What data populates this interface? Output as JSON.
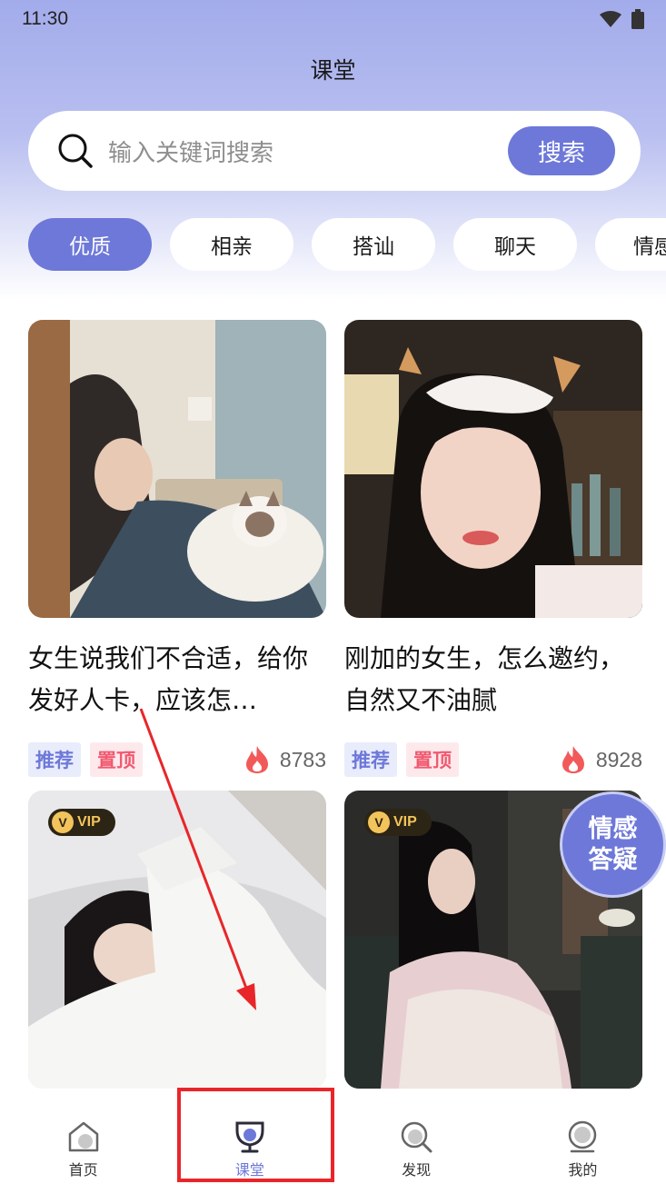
{
  "status_bar": {
    "time": "11:30"
  },
  "header": {
    "title": "课堂"
  },
  "search": {
    "placeholder": "输入关键词搜索",
    "button_label": "搜索"
  },
  "tabs": [
    {
      "label": "优质",
      "active": true
    },
    {
      "label": "相亲",
      "active": false
    },
    {
      "label": "搭讪",
      "active": false
    },
    {
      "label": "聊天",
      "active": false
    },
    {
      "label": "情感",
      "active": false
    }
  ],
  "cards": [
    {
      "title": "女生说我们不合适，给你发好人卡，应该怎…",
      "tags": [
        "推荐",
        "置顶"
      ],
      "hot_count": "8783"
    },
    {
      "title": "刚加的女生，怎么邀约，自然又不油腻",
      "tags": [
        "推荐",
        "置顶"
      ],
      "hot_count": "8928"
    },
    {
      "vip_label": "VIP"
    },
    {
      "vip_label": "VIP"
    }
  ],
  "float_badge": {
    "line1": "情感",
    "line2": "答疑"
  },
  "bottom_nav": [
    {
      "label": "首页",
      "icon": "home-icon",
      "active": false
    },
    {
      "label": "课堂",
      "icon": "trophy-icon",
      "active": true
    },
    {
      "label": "发现",
      "icon": "discover-icon",
      "active": false
    },
    {
      "label": "我的",
      "icon": "profile-icon",
      "active": false
    }
  ],
  "colors": {
    "accent": "#6d78d9",
    "header_gradient": "#a3aceb",
    "tag_red": "#f05a70",
    "highlight": "#e8262a"
  }
}
